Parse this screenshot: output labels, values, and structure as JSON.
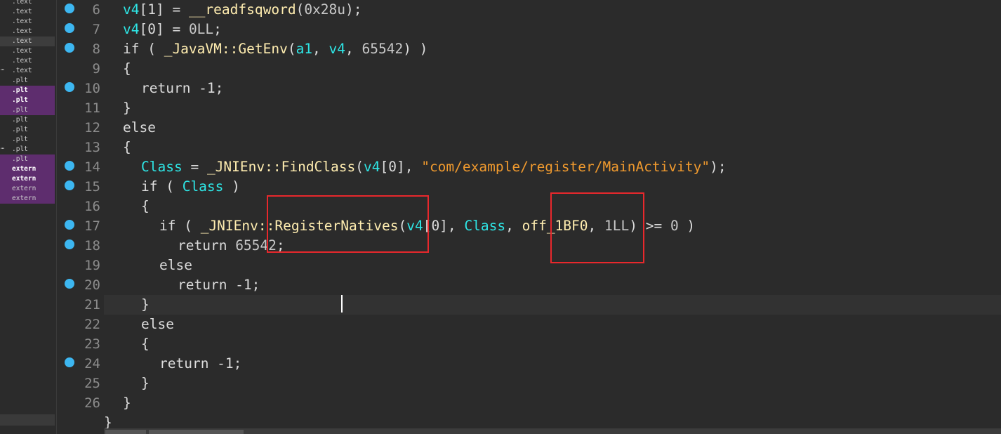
{
  "segments": [
    {
      "label": ".text",
      "style": "normal",
      "mark": ""
    },
    {
      "label": ".text",
      "style": "normal",
      "mark": ""
    },
    {
      "label": ".text",
      "style": "normal",
      "mark": ""
    },
    {
      "label": ".text",
      "style": "normal",
      "mark": ""
    },
    {
      "label": ".text",
      "style": "selected",
      "mark": ""
    },
    {
      "label": ".text",
      "style": "normal",
      "mark": ""
    },
    {
      "label": ".text",
      "style": "normal",
      "mark": ""
    },
    {
      "label": ".text",
      "style": "normal",
      "mark": "⋯"
    },
    {
      "label": ".plt",
      "style": "normal",
      "mark": ""
    },
    {
      "label": ".plt",
      "style": "highlight-bold",
      "mark": ""
    },
    {
      "label": ".plt",
      "style": "highlight-bold",
      "mark": ""
    },
    {
      "label": ".plt",
      "style": "highlight",
      "mark": ""
    },
    {
      "label": ".plt",
      "style": "normal",
      "mark": ""
    },
    {
      "label": ".plt",
      "style": "normal",
      "mark": ""
    },
    {
      "label": ".plt",
      "style": "normal",
      "mark": ""
    },
    {
      "label": ".plt",
      "style": "normal",
      "mark": "⋯"
    },
    {
      "label": ".plt",
      "style": "highlight",
      "mark": ""
    },
    {
      "label": "extern",
      "style": "highlight-bold",
      "mark": ""
    },
    {
      "label": "extern",
      "style": "highlight-bold",
      "mark": ""
    },
    {
      "label": "extern",
      "style": "highlight",
      "mark": ""
    },
    {
      "label": "extern",
      "style": "highlight",
      "mark": ""
    }
  ],
  "code_lines": [
    {
      "num": "6",
      "bp": true,
      "indent": 1,
      "tokens": [
        [
          "v4",
          "var"
        ],
        [
          "[1] = ",
          "op"
        ],
        [
          "__readfsqword",
          "fn"
        ],
        [
          "(",
          "op"
        ],
        [
          "0x28u",
          "num"
        ],
        [
          ");",
          "op"
        ]
      ]
    },
    {
      "num": "7",
      "bp": true,
      "indent": 1,
      "tokens": [
        [
          "v4",
          "var"
        ],
        [
          "[0] = ",
          "op"
        ],
        [
          "0LL",
          "num"
        ],
        [
          ";",
          "op"
        ]
      ]
    },
    {
      "num": "8",
      "bp": true,
      "indent": 1,
      "tokens": [
        [
          "if ( ",
          "op"
        ],
        [
          "_JavaVM::GetEnv",
          "fn"
        ],
        [
          "(",
          "op"
        ],
        [
          "a1",
          "var"
        ],
        [
          ", ",
          "op"
        ],
        [
          "v4",
          "var"
        ],
        [
          ", ",
          "op"
        ],
        [
          "65542",
          "num"
        ],
        [
          ") )",
          "op"
        ]
      ]
    },
    {
      "num": "9",
      "bp": false,
      "indent": 1,
      "tokens": [
        [
          "{",
          "op"
        ]
      ]
    },
    {
      "num": "10",
      "bp": true,
      "indent": 2,
      "tokens": [
        [
          "return -1;",
          "op"
        ]
      ]
    },
    {
      "num": "11",
      "bp": false,
      "indent": 1,
      "tokens": [
        [
          "}",
          "op"
        ]
      ]
    },
    {
      "num": "12",
      "bp": false,
      "indent": 1,
      "tokens": [
        [
          "else",
          "op"
        ]
      ]
    },
    {
      "num": "13",
      "bp": false,
      "indent": 1,
      "tokens": [
        [
          "{",
          "op"
        ]
      ]
    },
    {
      "num": "14",
      "bp": true,
      "indent": 2,
      "tokens": [
        [
          "Class",
          "var"
        ],
        [
          " = ",
          "op"
        ],
        [
          "_JNIEnv::FindClass",
          "fn"
        ],
        [
          "(",
          "op"
        ],
        [
          "v4",
          "var"
        ],
        [
          "[0], ",
          "op"
        ],
        [
          "\"com/example/register/MainActivity\"",
          "str"
        ],
        [
          ");",
          "op"
        ]
      ]
    },
    {
      "num": "15",
      "bp": true,
      "indent": 2,
      "tokens": [
        [
          "if ( ",
          "op"
        ],
        [
          "Class",
          "var"
        ],
        [
          " )",
          "op"
        ]
      ]
    },
    {
      "num": "16",
      "bp": false,
      "indent": 2,
      "tokens": [
        [
          "{",
          "op"
        ]
      ]
    },
    {
      "num": "17",
      "bp": true,
      "indent": 3,
      "tokens": [
        [
          "if ( ",
          "op"
        ],
        [
          "_JNIEnv::RegisterNatives",
          "fn"
        ],
        [
          "(",
          "op"
        ],
        [
          "v4",
          "var"
        ],
        [
          "[0], ",
          "op"
        ],
        [
          "Class",
          "var"
        ],
        [
          ", ",
          "op"
        ],
        [
          "off_1BF0",
          "data"
        ],
        [
          ", ",
          "op"
        ],
        [
          "1LL",
          "num"
        ],
        [
          ") >= ",
          "op"
        ],
        [
          "0",
          "num"
        ],
        [
          " )",
          "op"
        ]
      ]
    },
    {
      "num": "18",
      "bp": true,
      "indent": 4,
      "tokens": [
        [
          "return ",
          "op"
        ],
        [
          "65542",
          "num"
        ],
        [
          ";",
          "op"
        ]
      ]
    },
    {
      "num": "19",
      "bp": false,
      "indent": 3,
      "tokens": [
        [
          "else",
          "op"
        ]
      ]
    },
    {
      "num": "20",
      "bp": true,
      "indent": 4,
      "tokens": [
        [
          "return -1;",
          "op"
        ]
      ]
    },
    {
      "num": "21",
      "bp": false,
      "indent": 2,
      "current": true,
      "tokens": [
        [
          "}",
          "op"
        ]
      ]
    },
    {
      "num": "22",
      "bp": false,
      "indent": 2,
      "tokens": [
        [
          "else",
          "op"
        ]
      ]
    },
    {
      "num": "23",
      "bp": false,
      "indent": 2,
      "tokens": [
        [
          "{",
          "op"
        ]
      ]
    },
    {
      "num": "24",
      "bp": true,
      "indent": 3,
      "tokens": [
        [
          "return -1;",
          "op"
        ]
      ]
    },
    {
      "num": "25",
      "bp": false,
      "indent": 2,
      "tokens": [
        [
          "}",
          "op"
        ]
      ]
    },
    {
      "num": "26",
      "bp": false,
      "indent": 1,
      "tokens": [
        [
          "}",
          "op"
        ]
      ]
    },
    {
      "num": "",
      "bp": false,
      "indent": 0,
      "tokens": [
        [
          "}",
          "op"
        ]
      ]
    }
  ],
  "colors": {
    "background": "#2b2b2b",
    "breakpoint": "#3db7f1",
    "function": "#ffedb0",
    "variable": "#2ee6e6",
    "string": "#f09a2e",
    "highlight_box": "#e8282c",
    "segment_highlight": "#5e2d6e"
  }
}
